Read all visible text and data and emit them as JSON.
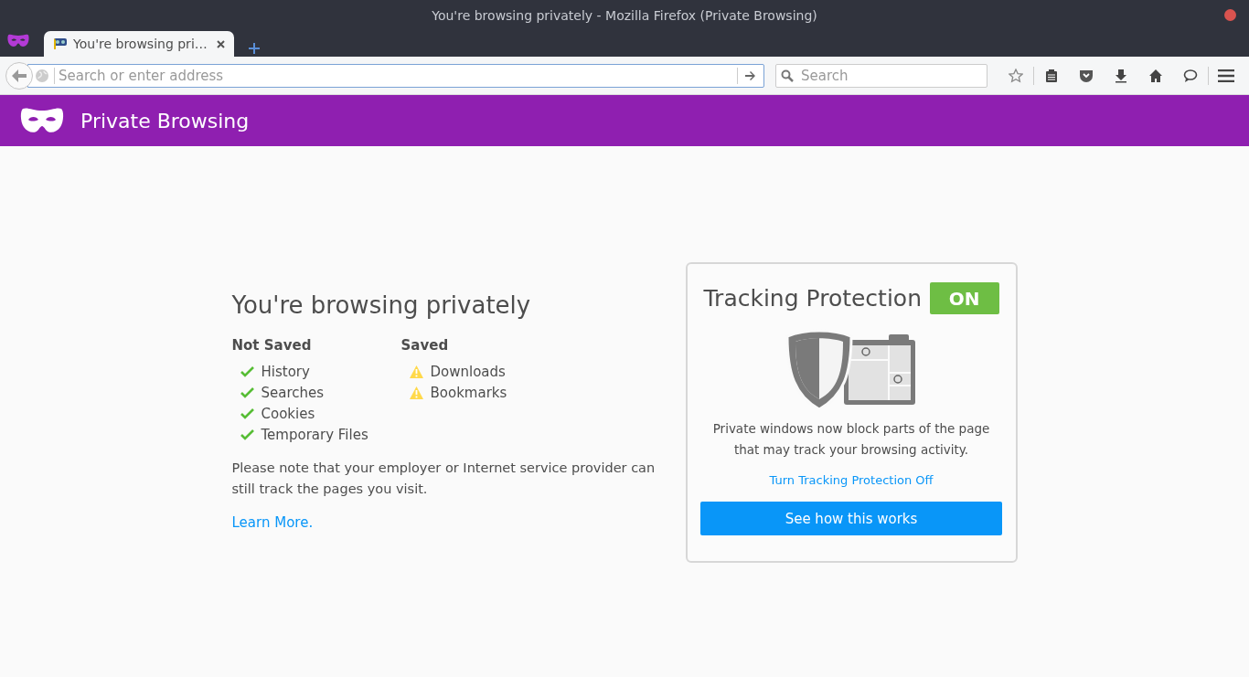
{
  "window": {
    "title": "You're browsing privately - Mozilla Firefox (Private Browsing)"
  },
  "tabs": [
    {
      "label": "You're browsing pri…",
      "selected": true
    }
  ],
  "toolbar": {
    "address": {
      "placeholder": "Search or enter address"
    },
    "search": {
      "placeholder": "Search"
    }
  },
  "banner": {
    "title": "Private Browsing"
  },
  "main": {
    "heading": "You're browsing privately",
    "columns": [
      {
        "heading": "Not Saved",
        "kind": "check",
        "items": [
          "History",
          "Searches",
          "Cookies",
          "Temporary Files"
        ]
      },
      {
        "heading": "Saved",
        "kind": "warning",
        "items": [
          "Downloads",
          "Bookmarks"
        ]
      }
    ],
    "note": "Please note that your employer or Internet service provider can still track the pages you visit.",
    "link": "Learn More."
  },
  "tracking": {
    "title": "Tracking Protection",
    "on": true,
    "status": "ON",
    "description": "Private windows now block parts of the page that may track your browsing activity.",
    "link": "Turn Tracking Protection Off",
    "button": "See how this works"
  }
}
